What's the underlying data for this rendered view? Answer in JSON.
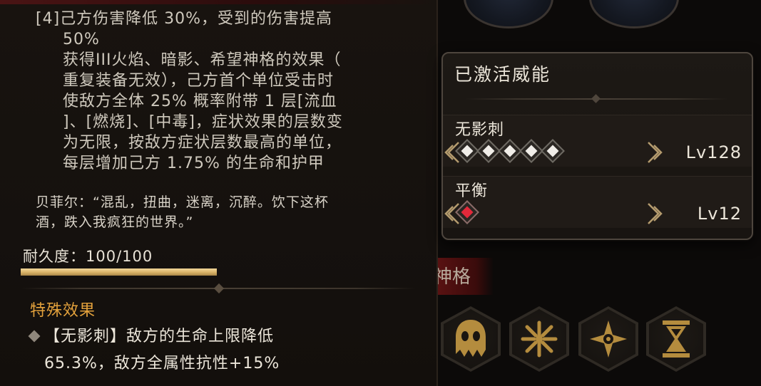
{
  "item_tooltip": {
    "set_effect_lines": [
      "[4]己方伤害降低 30%，受到的伤害提高",
      "50%",
      "获得III火焰、暗影、希望神格的效果（",
      "重复装备无效），己方首个单位受击时",
      "使敌方全体 25% 概率附带 1 层[流血",
      "]、[燃烧]、[中毒]，症状效果的层数变",
      "为无限，按敌方症状层数最高的单位，",
      "每层增加己方 1.75% 的生命和护甲"
    ],
    "quote_lines": [
      "贝菲尔：“混乱，扭曲，迷离，沉醉。饮下这杯",
      "酒，跌入我疯狂的世界。”"
    ],
    "durability": {
      "label": "耐久度：100/100",
      "current": 100,
      "max": 100
    },
    "special_effect": {
      "title": "特殊效果",
      "lines": [
        "【无影刺】敌方的生命上限降低",
        "65.3%，敌方全属性抗性+15%"
      ]
    }
  },
  "background": {
    "tag_text": "神格"
  },
  "power_popup": {
    "title": "已激活威能",
    "powers": [
      {
        "name": "无影刺",
        "level": "Lv128",
        "gems": 5,
        "gem_color": "#f0ede8"
      },
      {
        "name": "平衡",
        "level": "Lv12",
        "gems": 1,
        "gem_color": "#e2293a"
      }
    ]
  },
  "icons": [
    "ghost-skull-icon",
    "cracked-sigil-icon",
    "shuriken-compass-icon",
    "hourglass-icon"
  ],
  "colors": {
    "accent_gold": "#e4a23c",
    "durability_bar": "#d8b267",
    "gem_white": "#f0ede8",
    "gem_red": "#e2293a"
  }
}
